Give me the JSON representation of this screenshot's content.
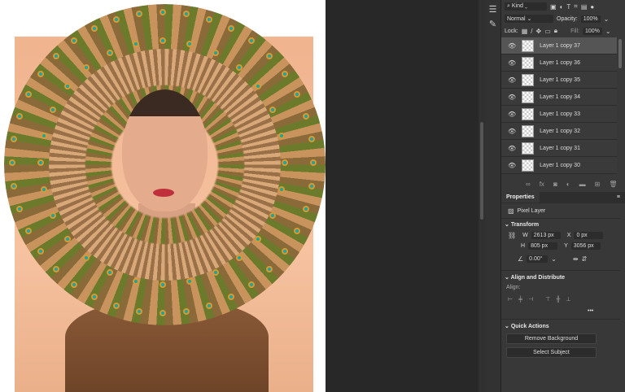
{
  "layers_panel": {
    "filter_kind": "Kind",
    "blend_mode": "Normal",
    "opacity_label": "Opacity:",
    "opacity_value": "100%",
    "lock_label": "Lock:",
    "fill_label": "Fill:",
    "fill_value": "100%",
    "layers": [
      {
        "name": "Layer 1 copy 37",
        "selected": true
      },
      {
        "name": "Layer 1 copy 36"
      },
      {
        "name": "Layer 1 copy 35"
      },
      {
        "name": "Layer 1 copy 34"
      },
      {
        "name": "Layer 1 copy 33"
      },
      {
        "name": "Layer 1 copy 32"
      },
      {
        "name": "Layer 1 copy 31"
      },
      {
        "name": "Layer 1 copy 30"
      }
    ]
  },
  "properties": {
    "tab": "Properties",
    "layer_type": "Pixel Layer",
    "transform_title": "Transform",
    "w_label": "W",
    "w_value": "2613 px",
    "h_label": "H",
    "h_value": "805 px",
    "x_label": "X",
    "x_value": "0 px",
    "y_label": "Y",
    "y_value": "3056 px",
    "angle_value": "0.00°",
    "align_title": "Align and Distribute",
    "align_label": "Align:",
    "more": "•••",
    "quick_title": "Quick Actions",
    "remove_bg": "Remove Background",
    "select_subject": "Select Subject"
  }
}
